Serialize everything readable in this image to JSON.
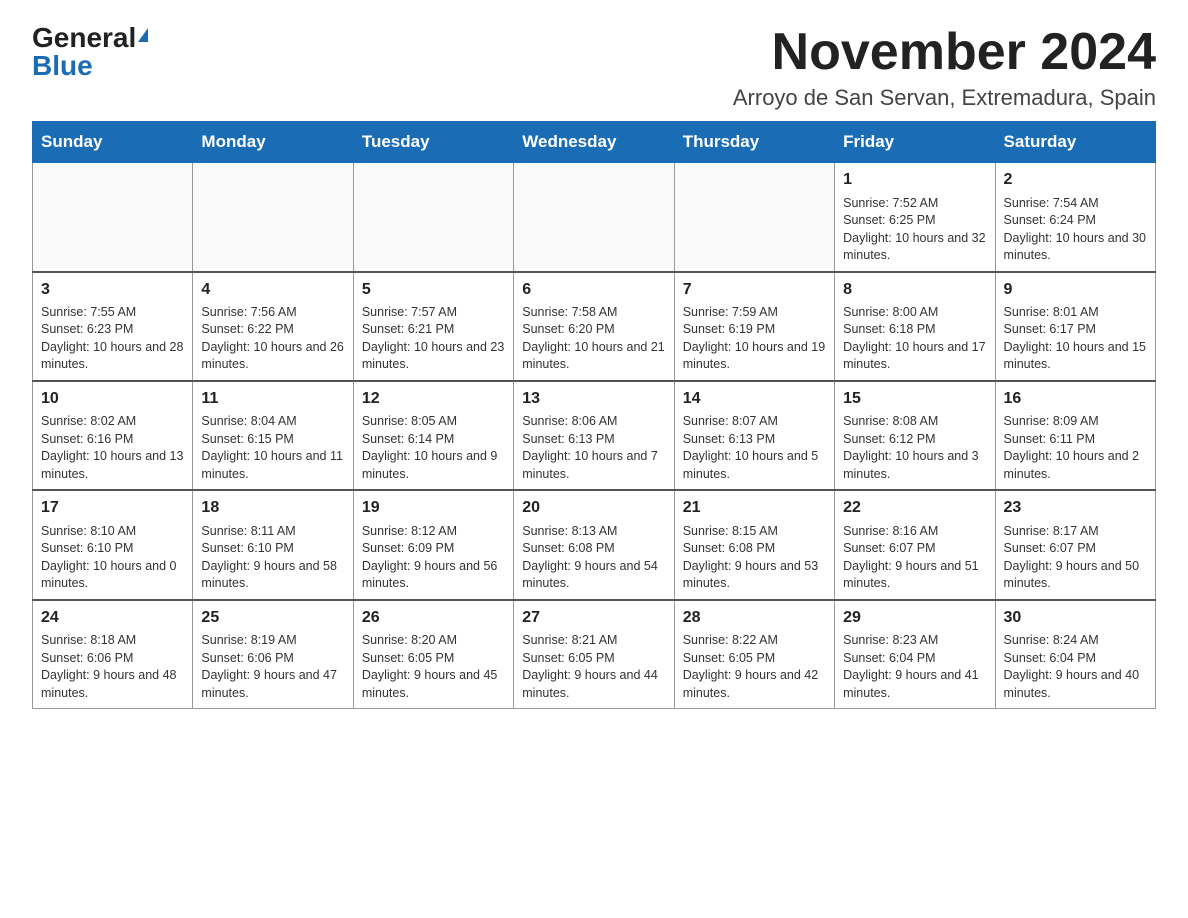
{
  "header": {
    "logo_general": "General",
    "logo_blue": "Blue",
    "month_title": "November 2024",
    "location": "Arroyo de San Servan, Extremadura, Spain"
  },
  "weekdays": [
    "Sunday",
    "Monday",
    "Tuesday",
    "Wednesday",
    "Thursday",
    "Friday",
    "Saturday"
  ],
  "weeks": [
    [
      {
        "day": "",
        "info": ""
      },
      {
        "day": "",
        "info": ""
      },
      {
        "day": "",
        "info": ""
      },
      {
        "day": "",
        "info": ""
      },
      {
        "day": "",
        "info": ""
      },
      {
        "day": "1",
        "info": "Sunrise: 7:52 AM\nSunset: 6:25 PM\nDaylight: 10 hours and 32 minutes."
      },
      {
        "day": "2",
        "info": "Sunrise: 7:54 AM\nSunset: 6:24 PM\nDaylight: 10 hours and 30 minutes."
      }
    ],
    [
      {
        "day": "3",
        "info": "Sunrise: 7:55 AM\nSunset: 6:23 PM\nDaylight: 10 hours and 28 minutes."
      },
      {
        "day": "4",
        "info": "Sunrise: 7:56 AM\nSunset: 6:22 PM\nDaylight: 10 hours and 26 minutes."
      },
      {
        "day": "5",
        "info": "Sunrise: 7:57 AM\nSunset: 6:21 PM\nDaylight: 10 hours and 23 minutes."
      },
      {
        "day": "6",
        "info": "Sunrise: 7:58 AM\nSunset: 6:20 PM\nDaylight: 10 hours and 21 minutes."
      },
      {
        "day": "7",
        "info": "Sunrise: 7:59 AM\nSunset: 6:19 PM\nDaylight: 10 hours and 19 minutes."
      },
      {
        "day": "8",
        "info": "Sunrise: 8:00 AM\nSunset: 6:18 PM\nDaylight: 10 hours and 17 minutes."
      },
      {
        "day": "9",
        "info": "Sunrise: 8:01 AM\nSunset: 6:17 PM\nDaylight: 10 hours and 15 minutes."
      }
    ],
    [
      {
        "day": "10",
        "info": "Sunrise: 8:02 AM\nSunset: 6:16 PM\nDaylight: 10 hours and 13 minutes."
      },
      {
        "day": "11",
        "info": "Sunrise: 8:04 AM\nSunset: 6:15 PM\nDaylight: 10 hours and 11 minutes."
      },
      {
        "day": "12",
        "info": "Sunrise: 8:05 AM\nSunset: 6:14 PM\nDaylight: 10 hours and 9 minutes."
      },
      {
        "day": "13",
        "info": "Sunrise: 8:06 AM\nSunset: 6:13 PM\nDaylight: 10 hours and 7 minutes."
      },
      {
        "day": "14",
        "info": "Sunrise: 8:07 AM\nSunset: 6:13 PM\nDaylight: 10 hours and 5 minutes."
      },
      {
        "day": "15",
        "info": "Sunrise: 8:08 AM\nSunset: 6:12 PM\nDaylight: 10 hours and 3 minutes."
      },
      {
        "day": "16",
        "info": "Sunrise: 8:09 AM\nSunset: 6:11 PM\nDaylight: 10 hours and 2 minutes."
      }
    ],
    [
      {
        "day": "17",
        "info": "Sunrise: 8:10 AM\nSunset: 6:10 PM\nDaylight: 10 hours and 0 minutes."
      },
      {
        "day": "18",
        "info": "Sunrise: 8:11 AM\nSunset: 6:10 PM\nDaylight: 9 hours and 58 minutes."
      },
      {
        "day": "19",
        "info": "Sunrise: 8:12 AM\nSunset: 6:09 PM\nDaylight: 9 hours and 56 minutes."
      },
      {
        "day": "20",
        "info": "Sunrise: 8:13 AM\nSunset: 6:08 PM\nDaylight: 9 hours and 54 minutes."
      },
      {
        "day": "21",
        "info": "Sunrise: 8:15 AM\nSunset: 6:08 PM\nDaylight: 9 hours and 53 minutes."
      },
      {
        "day": "22",
        "info": "Sunrise: 8:16 AM\nSunset: 6:07 PM\nDaylight: 9 hours and 51 minutes."
      },
      {
        "day": "23",
        "info": "Sunrise: 8:17 AM\nSunset: 6:07 PM\nDaylight: 9 hours and 50 minutes."
      }
    ],
    [
      {
        "day": "24",
        "info": "Sunrise: 8:18 AM\nSunset: 6:06 PM\nDaylight: 9 hours and 48 minutes."
      },
      {
        "day": "25",
        "info": "Sunrise: 8:19 AM\nSunset: 6:06 PM\nDaylight: 9 hours and 47 minutes."
      },
      {
        "day": "26",
        "info": "Sunrise: 8:20 AM\nSunset: 6:05 PM\nDaylight: 9 hours and 45 minutes."
      },
      {
        "day": "27",
        "info": "Sunrise: 8:21 AM\nSunset: 6:05 PM\nDaylight: 9 hours and 44 minutes."
      },
      {
        "day": "28",
        "info": "Sunrise: 8:22 AM\nSunset: 6:05 PM\nDaylight: 9 hours and 42 minutes."
      },
      {
        "day": "29",
        "info": "Sunrise: 8:23 AM\nSunset: 6:04 PM\nDaylight: 9 hours and 41 minutes."
      },
      {
        "day": "30",
        "info": "Sunrise: 8:24 AM\nSunset: 6:04 PM\nDaylight: 9 hours and 40 minutes."
      }
    ]
  ]
}
